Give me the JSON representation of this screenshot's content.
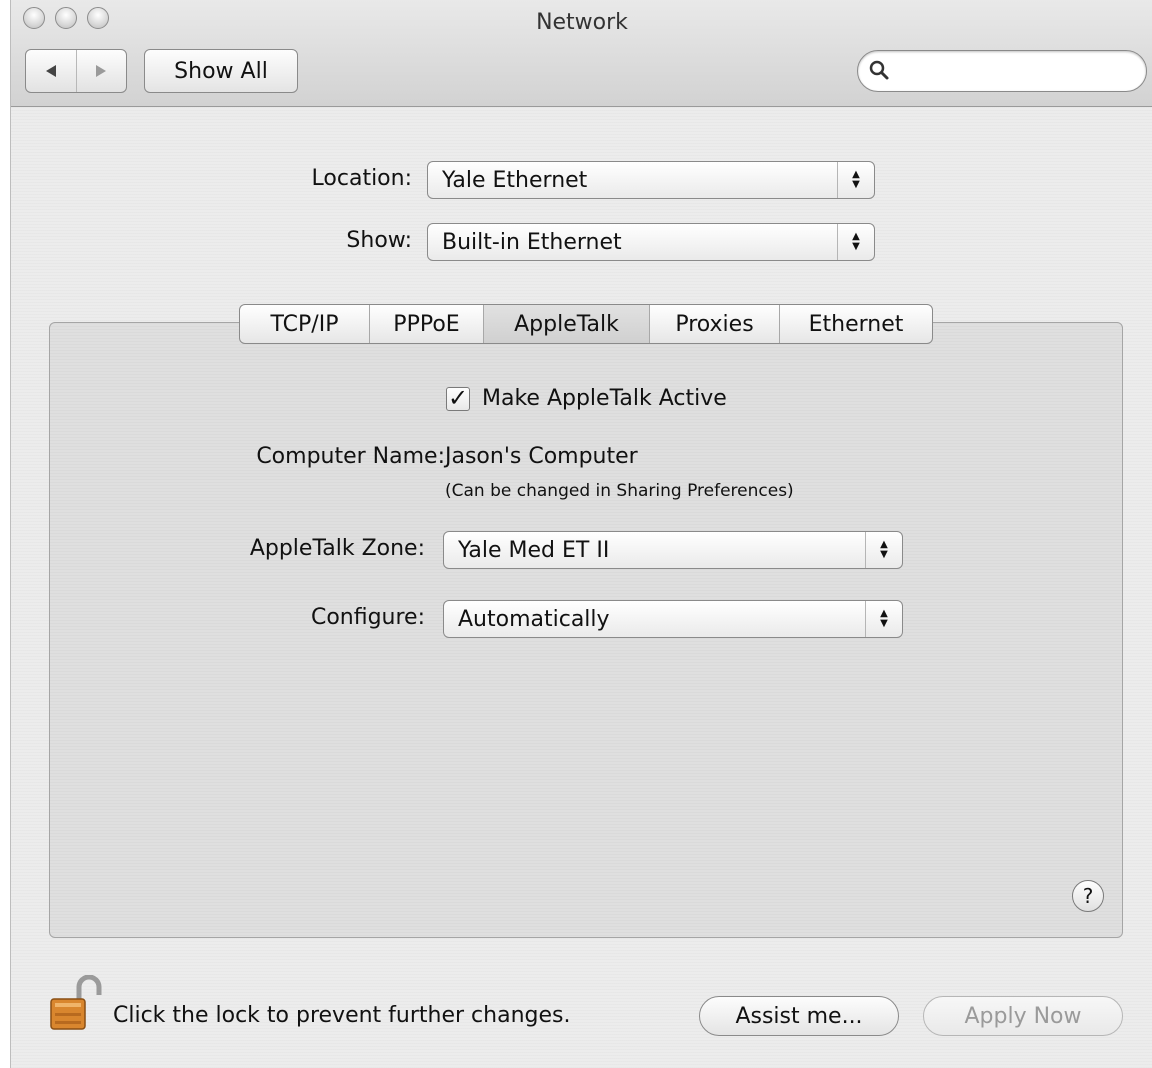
{
  "window": {
    "title": "Network"
  },
  "toolbar": {
    "back_icon": "back-arrow",
    "forward_icon": "forward-arrow",
    "show_all_label": "Show All",
    "search_placeholder": "",
    "search_icon": "magnifier"
  },
  "location": {
    "label": "Location:",
    "value": "Yale Ethernet"
  },
  "show": {
    "label": "Show:",
    "value": "Built-in Ethernet"
  },
  "tabs": [
    {
      "label": "TCP/IP"
    },
    {
      "label": "PPPoE"
    },
    {
      "label": "AppleTalk",
      "selected": true
    },
    {
      "label": "Proxies"
    },
    {
      "label": "Ethernet"
    }
  ],
  "appletalk": {
    "active_label": "Make AppleTalk Active",
    "active_checked": true,
    "computer_name_label": "Computer Name:",
    "computer_name_value": "Jason's Computer",
    "computer_name_note": "(Can be changed in Sharing Preferences)",
    "zone_label": "AppleTalk Zone:",
    "zone_value": "Yale Med ET II",
    "configure_label": "Configure:",
    "configure_value": "Automatically"
  },
  "footer": {
    "lock_text": "Click the lock to prevent further changes.",
    "assist_label": "Assist me...",
    "apply_label": "Apply Now",
    "help_symbol": "?"
  }
}
